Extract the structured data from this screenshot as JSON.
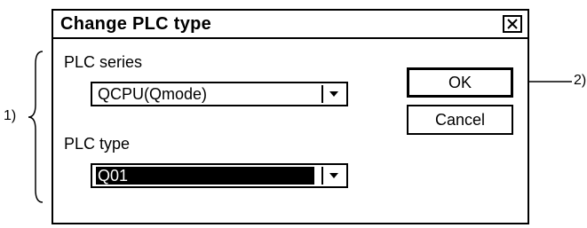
{
  "dialog": {
    "title": "Change PLC type",
    "close_icon": "close-icon"
  },
  "series": {
    "label": "PLC series",
    "value": "QCPU(Qmode)"
  },
  "type": {
    "label": "PLC type",
    "value": "Q01"
  },
  "buttons": {
    "ok": "OK",
    "cancel": "Cancel"
  },
  "annotations": {
    "left": "1)",
    "right": "2)"
  }
}
